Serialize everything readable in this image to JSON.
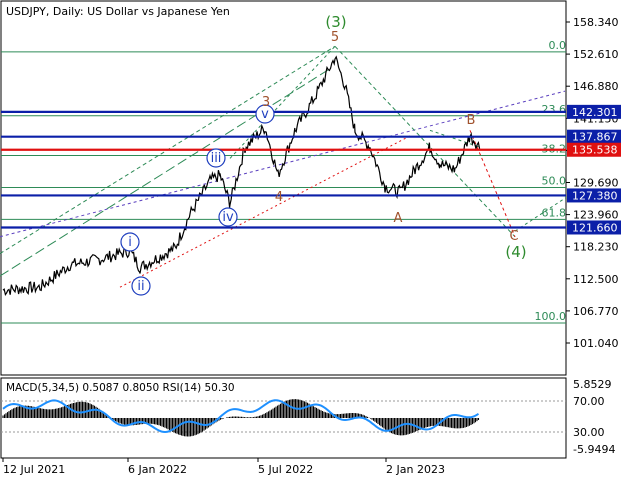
{
  "header": {
    "symbol_title": "USDJPY, Daily:  US Dollar vs Japanese Yen"
  },
  "price_axis": {
    "ticks": [
      "158.340",
      "152.610",
      "146.880",
      "141.150",
      "135.420",
      "129.690",
      "123.960",
      "118.230",
      "112.500",
      "106.770",
      "101.040"
    ],
    "tick_values": [
      158.34,
      152.61,
      146.88,
      141.15,
      135.42,
      129.69,
      123.96,
      118.23,
      112.5,
      106.77,
      101.04
    ]
  },
  "time_axis": {
    "labels": [
      "12 Jul 2021",
      "6 Jan 2022",
      "5 Jul 2022",
      "2 Jan 2023"
    ]
  },
  "levels": [
    {
      "value": 142.301,
      "label": "142.301",
      "color": "#0b1fa8"
    },
    {
      "value": 137.867,
      "label": "137.867",
      "color": "#0b1fa8"
    },
    {
      "value": 135.538,
      "label": "135.538",
      "color": "#e01010"
    },
    {
      "value": 127.38,
      "label": "127.380",
      "color": "#0b1fa8"
    },
    {
      "value": 121.66,
      "label": "121.660",
      "color": "#0b1fa8"
    }
  ],
  "fibonacci": [
    {
      "label": "0.0",
      "value": 153.0
    },
    {
      "label": "23.6",
      "value": 141.6
    },
    {
      "label": "38.2",
      "value": 134.5
    },
    {
      "label": "50.0",
      "value": 128.8
    },
    {
      "label": "61.8",
      "value": 123.1
    },
    {
      "label": "100.0",
      "value": 104.6
    }
  ],
  "waves": {
    "circled_blue": [
      "i",
      "ii",
      "iii",
      "iv",
      "v"
    ],
    "major_green": [
      "(3)",
      "(4)"
    ],
    "minor_brown": [
      "3",
      "4",
      "5"
    ],
    "correction": [
      "A",
      "B",
      "C"
    ]
  },
  "indicator": {
    "title": "MACD(5,34,5) 0.5087 0.8050 RSI(14) 50.30",
    "ticks": [
      "5.8529",
      "70.00",
      "30.00",
      "-5.9494"
    ]
  },
  "colors": {
    "price": "#000000",
    "level_blue": "#0b1fa8",
    "level_red": "#e01010",
    "fib": "#2e8b57",
    "rsi": "#1e90ff",
    "wave_blue": "#1f3fbf",
    "wave_green": "#2e8b2e",
    "wave_brown": "#a0522d"
  }
}
